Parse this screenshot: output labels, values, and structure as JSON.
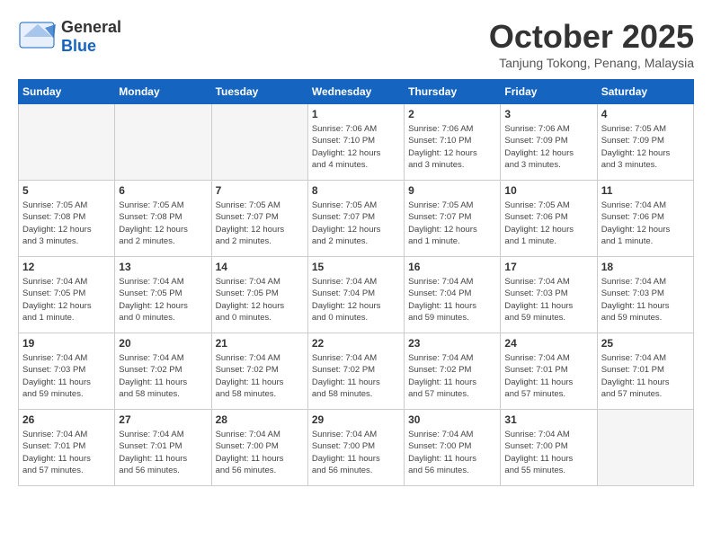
{
  "header": {
    "logo_general": "General",
    "logo_blue": "Blue",
    "month_title": "October 2025",
    "location": "Tanjung Tokong, Penang, Malaysia"
  },
  "calendar": {
    "days_of_week": [
      "Sunday",
      "Monday",
      "Tuesday",
      "Wednesday",
      "Thursday",
      "Friday",
      "Saturday"
    ],
    "weeks": [
      [
        {
          "day": "",
          "info": ""
        },
        {
          "day": "",
          "info": ""
        },
        {
          "day": "",
          "info": ""
        },
        {
          "day": "1",
          "info": "Sunrise: 7:06 AM\nSunset: 7:10 PM\nDaylight: 12 hours\nand 4 minutes."
        },
        {
          "day": "2",
          "info": "Sunrise: 7:06 AM\nSunset: 7:10 PM\nDaylight: 12 hours\nand 3 minutes."
        },
        {
          "day": "3",
          "info": "Sunrise: 7:06 AM\nSunset: 7:09 PM\nDaylight: 12 hours\nand 3 minutes."
        },
        {
          "day": "4",
          "info": "Sunrise: 7:05 AM\nSunset: 7:09 PM\nDaylight: 12 hours\nand 3 minutes."
        }
      ],
      [
        {
          "day": "5",
          "info": "Sunrise: 7:05 AM\nSunset: 7:08 PM\nDaylight: 12 hours\nand 3 minutes."
        },
        {
          "day": "6",
          "info": "Sunrise: 7:05 AM\nSunset: 7:08 PM\nDaylight: 12 hours\nand 2 minutes."
        },
        {
          "day": "7",
          "info": "Sunrise: 7:05 AM\nSunset: 7:07 PM\nDaylight: 12 hours\nand 2 minutes."
        },
        {
          "day": "8",
          "info": "Sunrise: 7:05 AM\nSunset: 7:07 PM\nDaylight: 12 hours\nand 2 minutes."
        },
        {
          "day": "9",
          "info": "Sunrise: 7:05 AM\nSunset: 7:07 PM\nDaylight: 12 hours\nand 1 minute."
        },
        {
          "day": "10",
          "info": "Sunrise: 7:05 AM\nSunset: 7:06 PM\nDaylight: 12 hours\nand 1 minute."
        },
        {
          "day": "11",
          "info": "Sunrise: 7:04 AM\nSunset: 7:06 PM\nDaylight: 12 hours\nand 1 minute."
        }
      ],
      [
        {
          "day": "12",
          "info": "Sunrise: 7:04 AM\nSunset: 7:05 PM\nDaylight: 12 hours\nand 1 minute."
        },
        {
          "day": "13",
          "info": "Sunrise: 7:04 AM\nSunset: 7:05 PM\nDaylight: 12 hours\nand 0 minutes."
        },
        {
          "day": "14",
          "info": "Sunrise: 7:04 AM\nSunset: 7:05 PM\nDaylight: 12 hours\nand 0 minutes."
        },
        {
          "day": "15",
          "info": "Sunrise: 7:04 AM\nSunset: 7:04 PM\nDaylight: 12 hours\nand 0 minutes."
        },
        {
          "day": "16",
          "info": "Sunrise: 7:04 AM\nSunset: 7:04 PM\nDaylight: 11 hours\nand 59 minutes."
        },
        {
          "day": "17",
          "info": "Sunrise: 7:04 AM\nSunset: 7:03 PM\nDaylight: 11 hours\nand 59 minutes."
        },
        {
          "day": "18",
          "info": "Sunrise: 7:04 AM\nSunset: 7:03 PM\nDaylight: 11 hours\nand 59 minutes."
        }
      ],
      [
        {
          "day": "19",
          "info": "Sunrise: 7:04 AM\nSunset: 7:03 PM\nDaylight: 11 hours\nand 59 minutes."
        },
        {
          "day": "20",
          "info": "Sunrise: 7:04 AM\nSunset: 7:02 PM\nDaylight: 11 hours\nand 58 minutes."
        },
        {
          "day": "21",
          "info": "Sunrise: 7:04 AM\nSunset: 7:02 PM\nDaylight: 11 hours\nand 58 minutes."
        },
        {
          "day": "22",
          "info": "Sunrise: 7:04 AM\nSunset: 7:02 PM\nDaylight: 11 hours\nand 58 minutes."
        },
        {
          "day": "23",
          "info": "Sunrise: 7:04 AM\nSunset: 7:02 PM\nDaylight: 11 hours\nand 57 minutes."
        },
        {
          "day": "24",
          "info": "Sunrise: 7:04 AM\nSunset: 7:01 PM\nDaylight: 11 hours\nand 57 minutes."
        },
        {
          "day": "25",
          "info": "Sunrise: 7:04 AM\nSunset: 7:01 PM\nDaylight: 11 hours\nand 57 minutes."
        }
      ],
      [
        {
          "day": "26",
          "info": "Sunrise: 7:04 AM\nSunset: 7:01 PM\nDaylight: 11 hours\nand 57 minutes."
        },
        {
          "day": "27",
          "info": "Sunrise: 7:04 AM\nSunset: 7:01 PM\nDaylight: 11 hours\nand 56 minutes."
        },
        {
          "day": "28",
          "info": "Sunrise: 7:04 AM\nSunset: 7:00 PM\nDaylight: 11 hours\nand 56 minutes."
        },
        {
          "day": "29",
          "info": "Sunrise: 7:04 AM\nSunset: 7:00 PM\nDaylight: 11 hours\nand 56 minutes."
        },
        {
          "day": "30",
          "info": "Sunrise: 7:04 AM\nSunset: 7:00 PM\nDaylight: 11 hours\nand 56 minutes."
        },
        {
          "day": "31",
          "info": "Sunrise: 7:04 AM\nSunset: 7:00 PM\nDaylight: 11 hours\nand 55 minutes."
        },
        {
          "day": "",
          "info": ""
        }
      ]
    ]
  }
}
